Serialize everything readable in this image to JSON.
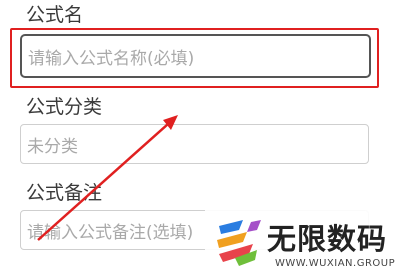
{
  "form": {
    "name_label": "公式名",
    "name_placeholder": "请输入公式名称(必填)",
    "category_label": "公式分类",
    "category_placeholder": "未分类",
    "note_label": "公式备注",
    "note_placeholder": "请输入公式备注(选填)"
  },
  "watermark": {
    "brand": "无限数码",
    "url": "WWW.WUXIAN.GROUP"
  },
  "colors": {
    "highlight": "#e02020",
    "arrow": "#e02020"
  }
}
